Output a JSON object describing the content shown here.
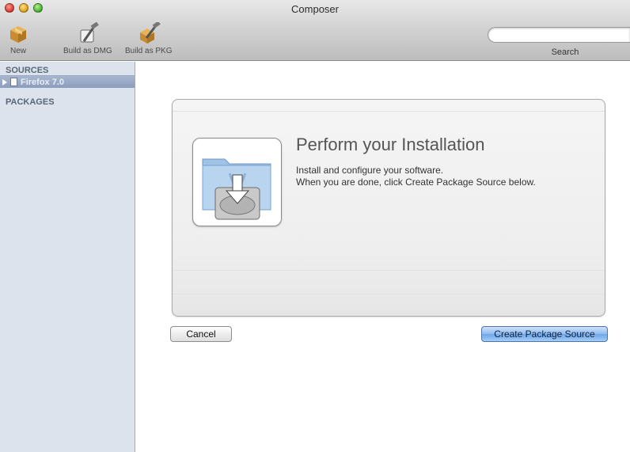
{
  "window": {
    "title": "Composer"
  },
  "toolbar": {
    "new_label": "New",
    "build_dmg_label": "Build as DMG",
    "build_pkg_label": "Build as PKG",
    "search_label": "Search",
    "search_value": ""
  },
  "sidebar": {
    "sources_heading": "SOURCES",
    "source_item": "Firefox 7.0",
    "packages_heading": "PACKAGES"
  },
  "panel": {
    "title": "Perform your Installation",
    "line1": "Install and configure your software.",
    "line2": "When you are done, click Create Package Source below."
  },
  "buttons": {
    "cancel": "Cancel",
    "create": "Create Package Source"
  },
  "colors": {
    "sidebar_bg": "#dce3ec",
    "selection": "#8b9dbd",
    "default_button": "#6ea5ea"
  }
}
